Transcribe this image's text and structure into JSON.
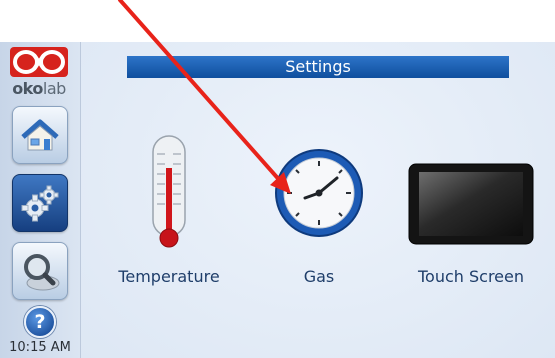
{
  "sidebar": {
    "logo_text_bold": "oko",
    "logo_text_rest": "lab",
    "buttons": [
      {
        "name": "home",
        "icon": "home-icon"
      },
      {
        "name": "settings",
        "icon": "gears-icon",
        "active": true
      },
      {
        "name": "search",
        "icon": "magnifier-icon"
      }
    ],
    "help_label": "?",
    "time": "10:15 AM"
  },
  "main": {
    "title": "Settings",
    "tiles": [
      {
        "label": "Temperature",
        "icon": "thermometer-icon"
      },
      {
        "label": "Gas",
        "icon": "gauge-icon"
      },
      {
        "label": "Touch Screen",
        "icon": "monitor-icon"
      }
    ]
  },
  "colors": {
    "title_bar": "#1e63b8",
    "arrow": "#e8231a",
    "active_button": "#2a5ea6"
  }
}
